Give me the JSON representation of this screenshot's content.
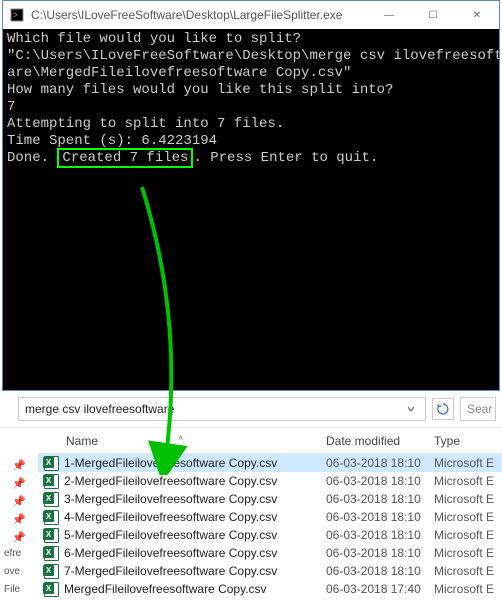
{
  "console": {
    "title": "C:\\Users\\ILoveFreeSoftware\\Desktop\\LargeFileSplitter.exe",
    "lines": {
      "l1": "Which file would you like to split?",
      "l2": "\"C:\\Users\\ILoveFreeSoftware\\Desktop\\merge csv ilovefreesoftw",
      "l3": "are\\MergedFileilovefreesoftware Copy.csv\"",
      "l4": "How many files would you like this split into?",
      "l5": "7",
      "l6": "Attempting to split into 7 files.",
      "l7": "Time Spent (s): 6.4223194",
      "done_prefix": "Done. ",
      "done_highlight": "Created 7 files",
      "done_suffix": ". Press Enter to quit."
    },
    "buttons": {
      "min": "—",
      "max": "☐",
      "close": "✕"
    }
  },
  "explorer": {
    "address": "merge csv ilovefreesoftware",
    "search_placeholder": "Sear",
    "headers": {
      "name": "Name",
      "date": "Date modified",
      "type": "Type"
    },
    "nav": [
      "efre",
      "ove",
      "File"
    ],
    "rows": [
      {
        "name": "1-MergedFileilovefreesoftware Copy.csv",
        "date": "06-03-2018 18:10",
        "type": "Microsoft E",
        "selected": true
      },
      {
        "name": "2-MergedFileilovefreesoftware Copy.csv",
        "date": "06-03-2018 18:10",
        "type": "Microsoft E",
        "selected": false
      },
      {
        "name": "3-MergedFileilovefreesoftware Copy.csv",
        "date": "06-03-2018 18:10",
        "type": "Microsoft E",
        "selected": false
      },
      {
        "name": "4-MergedFileilovefreesoftware Copy.csv",
        "date": "06-03-2018 18:10",
        "type": "Microsoft E",
        "selected": false
      },
      {
        "name": "5-MergedFileilovefreesoftware Copy.csv",
        "date": "06-03-2018 18:10",
        "type": "Microsoft E",
        "selected": false
      },
      {
        "name": "6-MergedFileilovefreesoftware Copy.csv",
        "date": "06-03-2018 18:10",
        "type": "Microsoft E",
        "selected": false
      },
      {
        "name": "7-MergedFileilovefreesoftware Copy.csv",
        "date": "06-03-2018 18:10",
        "type": "Microsoft E",
        "selected": false
      },
      {
        "name": "MergedFileilovefreesoftware Copy.csv",
        "date": "06-03-2018 17:40",
        "type": "Microsoft E",
        "selected": false
      }
    ]
  }
}
